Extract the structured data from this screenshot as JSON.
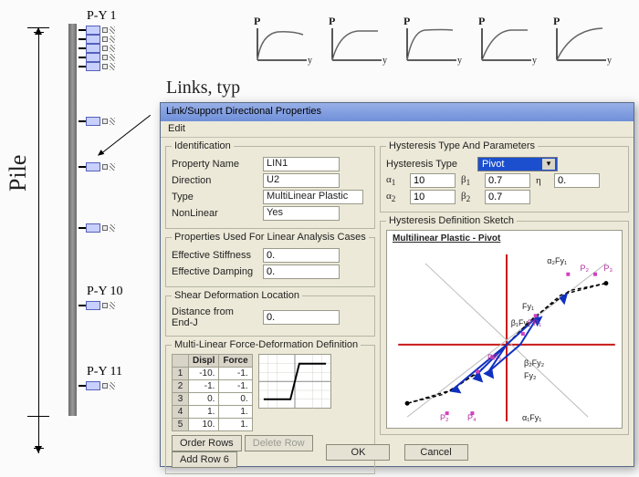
{
  "diagram": {
    "pile_label": "Pile",
    "links_label": "Links, typ",
    "py_labels": {
      "top": "P-Y  1",
      "mid": "P-Y  10",
      "bot": "P-Y  11"
    },
    "curve_p": "P",
    "curve_y": "y"
  },
  "dialog": {
    "title": "Link/Support Directional Properties",
    "menu": {
      "edit": "Edit"
    },
    "identification": {
      "legend": "Identification",
      "property_name_label": "Property Name",
      "property_name": "LIN1",
      "direction_label": "Direction",
      "direction": "U2",
      "type_label": "Type",
      "type": "MultiLinear Plastic",
      "nonlinear_label": "NonLinear",
      "nonlinear": "Yes"
    },
    "linear_cases": {
      "legend": "Properties Used For Linear Analysis Cases",
      "eff_stiff_label": "Effective Stiffness",
      "eff_stiff": "0.",
      "eff_damp_label": "Effective Damping",
      "eff_damp": "0."
    },
    "shear": {
      "legend": "Shear Deformation Location",
      "dist_label": "Distance from End-J",
      "dist": "0."
    },
    "mlfd": {
      "legend": "Multi-Linear Force-Deformation Definition",
      "col_displ": "Displ",
      "col_force": "Force",
      "rows": [
        {
          "n": "1",
          "displ": "-10.",
          "force": "-1."
        },
        {
          "n": "2",
          "displ": "-1.",
          "force": "-1."
        },
        {
          "n": "3",
          "displ": "0.",
          "force": "0."
        },
        {
          "n": "4",
          "displ": "1.",
          "force": "1."
        },
        {
          "n": "5",
          "displ": "10.",
          "force": "1."
        }
      ],
      "order_btn": "Order Rows",
      "delete_btn": "Delete Row",
      "add_btn": "Add Row 6"
    },
    "hysteresis": {
      "legend": "Hysteresis Type And Parameters",
      "type_label": "Hysteresis Type",
      "type": "Pivot",
      "a1_label": "α",
      "a1_sub": "1",
      "a1": "10",
      "a2_label": "α",
      "a2_sub": "2",
      "a2": "10",
      "b1_label": "β",
      "b1_sub": "1",
      "b1": "0.7",
      "b2_label": "β",
      "b2_sub": "2",
      "b2": "0.7",
      "eta_label": "η",
      "eta": "0."
    },
    "sketch": {
      "legend": "Hysteresis Definition Sketch",
      "title": "Multilinear Plastic - Pivot",
      "labels": {
        "a2Fy1": "α₂Fy₁",
        "P2t": "P₂",
        "P3": "P₃",
        "Fy1": "Fy₁",
        "b1Fy1": "β₁Fy₁",
        "PP1": "PP₁",
        "PP2": "PP₂",
        "b2Fy2": "β₂Fy₂",
        "Fy2": "Fy₂",
        "P2b": "P₂",
        "P4": "P₄",
        "a1Fy1": "α₁Fy₁"
      }
    },
    "buttons": {
      "ok": "OK",
      "cancel": "Cancel"
    }
  }
}
